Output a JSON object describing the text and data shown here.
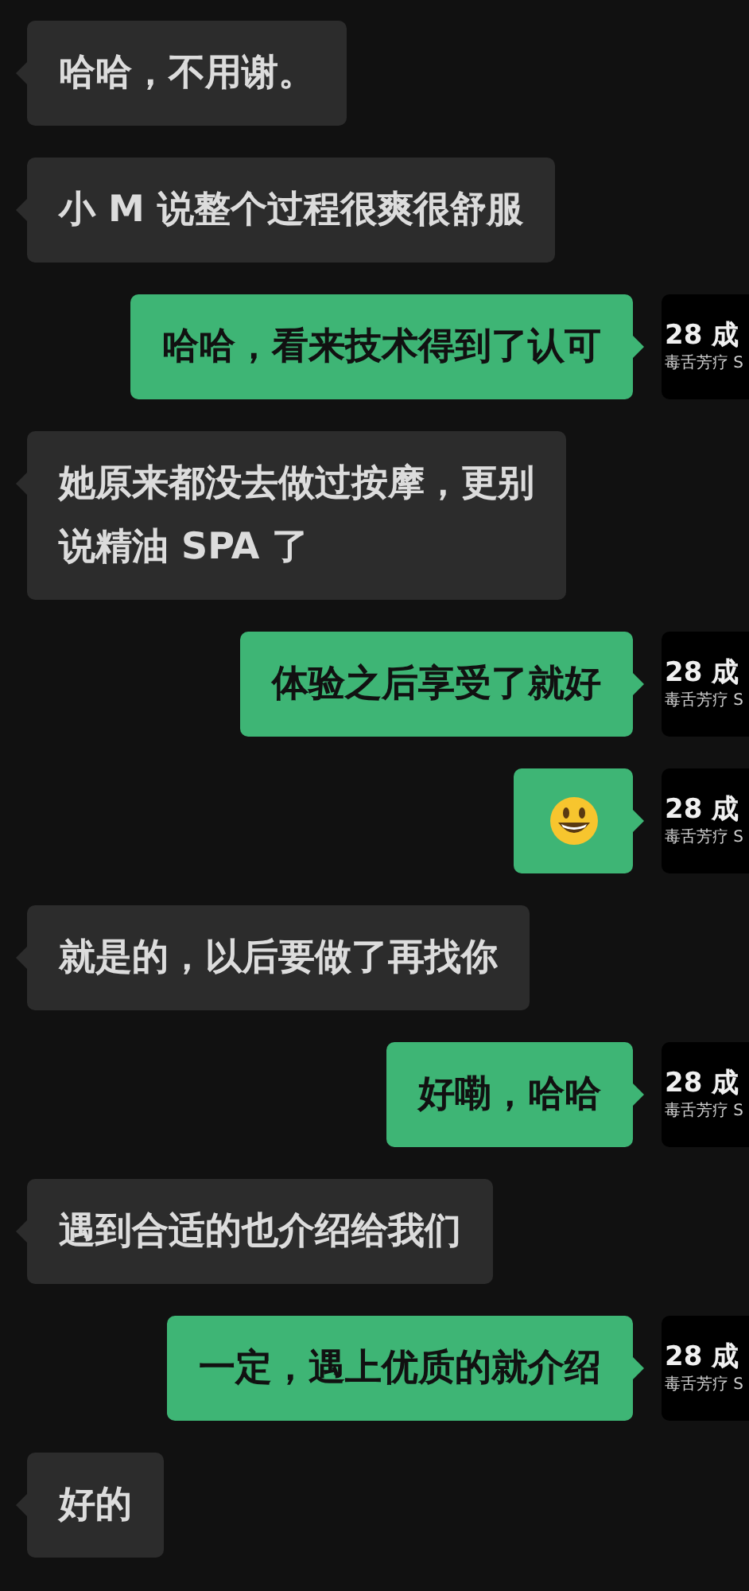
{
  "messages": [
    {
      "outgoing": false,
      "kind": "text",
      "lines": [
        "哈哈，不用谢。"
      ]
    },
    {
      "outgoing": false,
      "kind": "text",
      "lines": [
        "小 M 说整个过程很爽很舒服"
      ]
    },
    {
      "outgoing": true,
      "kind": "text",
      "lines": [
        "哈哈，看来技术得到了认可"
      ],
      "avatar": {
        "title": "28 成",
        "subtitle": "毒舌芳疗 S"
      }
    },
    {
      "outgoing": false,
      "kind": "text",
      "lines": [
        "她原来都没去做过按摩，更别",
        "说精油 SPA 了"
      ]
    },
    {
      "outgoing": true,
      "kind": "text",
      "lines": [
        "体验之后享受了就好"
      ],
      "avatar": {
        "title": "28 成",
        "subtitle": "毒舌芳疗 S"
      }
    },
    {
      "outgoing": true,
      "kind": "emoji",
      "avatar": {
        "title": "28 成",
        "subtitle": "毒舌芳疗 S"
      }
    },
    {
      "outgoing": false,
      "kind": "text",
      "lines": [
        "就是的，以后要做了再找你"
      ]
    },
    {
      "outgoing": true,
      "kind": "text",
      "lines": [
        "好嘞，哈哈"
      ],
      "avatar": {
        "title": "28 成",
        "subtitle": "毒舌芳疗 S"
      }
    },
    {
      "outgoing": false,
      "kind": "text",
      "lines": [
        "遇到合适的也介绍给我们"
      ]
    },
    {
      "outgoing": true,
      "kind": "text",
      "lines": [
        "一定，遇上优质的就介绍"
      ],
      "avatar": {
        "title": "28 成",
        "subtitle": "毒舌芳疗 S"
      }
    },
    {
      "outgoing": false,
      "kind": "text",
      "lines": [
        "好的"
      ]
    }
  ]
}
